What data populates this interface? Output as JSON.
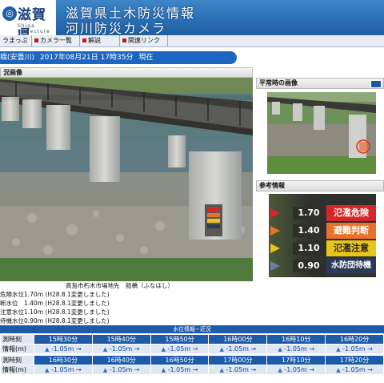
{
  "header": {
    "logo_mark": "◎",
    "logo_text": "滋賀県",
    "logo_sub": "Shiga Prefecture",
    "title_line1": "滋賀県土木防災情報",
    "title_line2": "河川防災カメラ"
  },
  "nav": {
    "items": [
      "ラまっぷ",
      "カメラ一覧",
      "解説",
      "関連リンク"
    ]
  },
  "camera": {
    "name": "橋(安曇川)",
    "datetime": "2017年08月21日 17時35分",
    "status": "現在"
  },
  "sections": {
    "live": "況画像",
    "normal": "平常時の画像",
    "reference": "参考情報"
  },
  "reference_levels": [
    {
      "value": "1.70",
      "label": "氾濫危険",
      "color": "#d6262a"
    },
    {
      "value": "1.40",
      "label": "避難判断",
      "color": "#e8722a"
    },
    {
      "value": "1.10",
      "label": "氾濫注意",
      "color": "#e9c419"
    },
    {
      "value": "0.90",
      "label": "水防団待機",
      "color": "#2b3a56"
    }
  ],
  "caption": "高島市朽木市場地先　船橋（ふなはし）",
  "levels": [
    "危険水位1.70m (H28.8.1変更しました)",
    "断水位　1.40m (H28.8.1変更しました)",
    "注意水位1.10m (H28.8.1変更しました)",
    "待機水位0.90m (H28.8.1変更しました)"
  ],
  "water_table": {
    "title": "水位情報−近況",
    "row_label_time": "測時刻",
    "row_label_info": "情報(m)",
    "block1_times": [
      "15時30分",
      "15時40分",
      "15時50分",
      "16時00分",
      "16時10分",
      "16時20分"
    ],
    "block1_values": [
      "-1.05m",
      "-1.05m",
      "-1.05m",
      "-1.05m",
      "-1.05m",
      "-1.05m"
    ],
    "block2_times": [
      "16時30分",
      "16時40分",
      "16時50分",
      "17時00分",
      "17時10分",
      "17時20分"
    ],
    "block2_values": [
      "-1.05m",
      "-1.05m",
      "-1.05m",
      "-1.05m",
      "-1.05m",
      "-1.05m"
    ],
    "arrow": "→",
    "level_icon": "▲"
  },
  "colors": {
    "header_blue": "#2a6fb4",
    "date_bar": "#1c66c1",
    "table_header": "#1d5aa8",
    "table_cell": "#dfe7f1"
  }
}
